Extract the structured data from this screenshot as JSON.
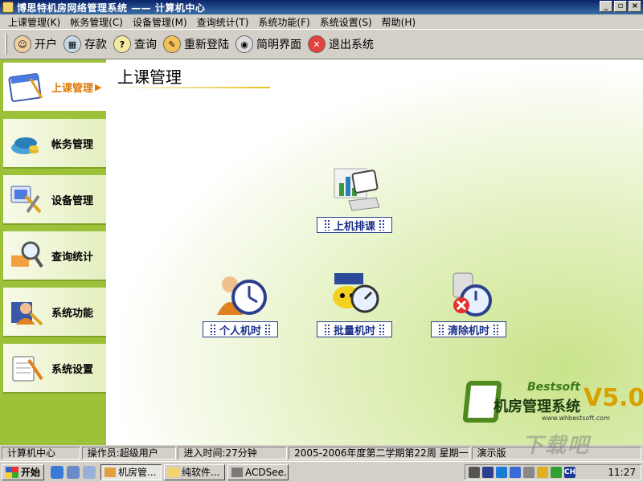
{
  "window": {
    "title": "博思特机房网络管理系统 —— 计算机中心",
    "btn_min": "_",
    "btn_max": "▫",
    "btn_close": "×"
  },
  "menu": [
    "上课管理(K)",
    "帐务管理(C)",
    "设备管理(M)",
    "查询统计(T)",
    "系统功能(F)",
    "系统设置(S)",
    "帮助(H)"
  ],
  "toolbar": [
    {
      "label": "开户",
      "icon": "open-account-icon",
      "color": "#f0d0a0"
    },
    {
      "label": "存款",
      "icon": "deposit-icon",
      "color": "#c8d8e8"
    },
    {
      "label": "查询",
      "icon": "query-icon",
      "color": "#f5e9a0"
    },
    {
      "label": "重新登陆",
      "icon": "relogin-icon",
      "color": "#f3c15a"
    },
    {
      "label": "简明界面",
      "icon": "simple-view-icon",
      "color": "#dcdcdc"
    },
    {
      "label": "退出系统",
      "icon": "exit-icon",
      "color": "#e54040"
    }
  ],
  "sidebar": [
    {
      "label": "上课管理",
      "icon": "calendar-icon",
      "active": true
    },
    {
      "label": "帐务管理",
      "icon": "coins-icon",
      "active": false
    },
    {
      "label": "设备管理",
      "icon": "tools-icon",
      "active": false
    },
    {
      "label": "查询统计",
      "icon": "magnifier-icon",
      "active": false
    },
    {
      "label": "系统功能",
      "icon": "user-key-icon",
      "active": false
    },
    {
      "label": "系统设置",
      "icon": "settings-icon",
      "active": false
    }
  ],
  "main": {
    "title": "上课管理",
    "features": {
      "schedule": {
        "label": "上机排课",
        "icon": "computer-schedule-icon"
      },
      "personal": {
        "label": "个人机时",
        "icon": "personal-clock-icon"
      },
      "batch": {
        "label": "批量机时",
        "icon": "batch-clock-icon"
      },
      "clear": {
        "label": "清除机时",
        "icon": "clear-clock-icon"
      }
    }
  },
  "brand": {
    "en": "Bestsoft",
    "cn": "机房管理系统",
    "version": "V5.0",
    "url": "www.whbestsoft.com"
  },
  "status": [
    "计算机中心",
    "操作员:超级用户",
    "进入时间:27分钟",
    "2005-2006年度第二学期第22周 星期一",
    "演示版"
  ],
  "taskbar": {
    "start": "开始",
    "tasks": [
      {
        "label": "机房管...",
        "active": true
      },
      {
        "label": "纯软件...",
        "active": false
      },
      {
        "label": "ACDSee...",
        "active": false
      }
    ],
    "tray_lang": "CH",
    "clock": "11:27"
  },
  "watermark": "下载吧"
}
